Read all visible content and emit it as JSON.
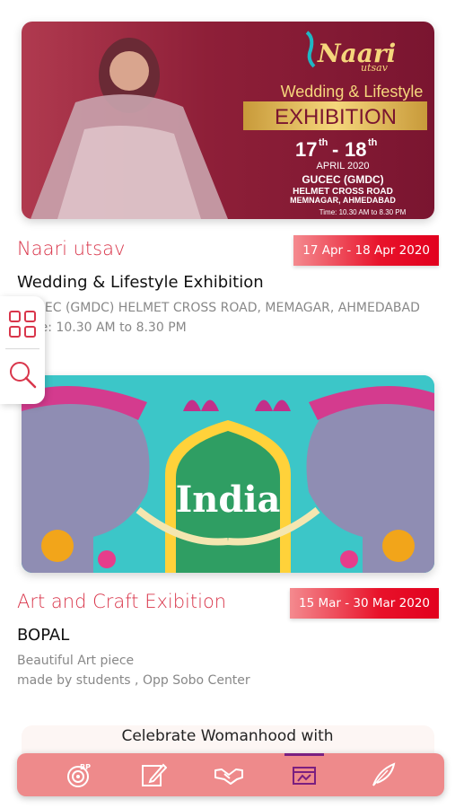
{
  "events": [
    {
      "banner": {
        "brand": "Naari",
        "brand_sub": "utsav",
        "headline_top": "Wedding & Lifestyle",
        "headline_main": "EXHIBITION",
        "date_day_start": "17",
        "date_sup_start": "th",
        "date_dash": "-",
        "date_day_end": "18",
        "date_sup_end": "th",
        "date_month_year": "APRIL 2020",
        "venue_line1": "GUCEC (GMDC)",
        "venue_line2": "HELMET CROSS ROAD",
        "venue_line3": "MEMNAGAR, AHMEDABAD",
        "time": "Time: 10.30 AM to 8.30 PM"
      },
      "title": "Naari utsav",
      "date_range": "17 Apr - 18 Apr 2020",
      "subtitle": "Wedding & Lifestyle Exhibition",
      "description_line1": "GUCEC (GMDC) HELMET CROSS ROAD, MEMAGAR, AHMEDABAD",
      "description_line2": "Time: 10.30 AM to 8.30 PM"
    },
    {
      "banner": {
        "word": "India"
      },
      "title": "Art and Craft Exibition",
      "date_range": "15 Mar - 30 Mar 2020",
      "subtitle": "BOPAL",
      "description_line1": "Beautiful Art piece",
      "description_line2": "made by students , Opp Sobo Center"
    }
  ],
  "next_card_peek": "Celebrate Womanhood with",
  "side_panel": {
    "icons": [
      "grid-icon",
      "search-icon"
    ]
  },
  "bottom_nav": {
    "items": [
      "bp-logo-icon",
      "edit-icon",
      "handshake-icon",
      "exhibition-icon",
      "feather-icon"
    ],
    "active_index": 3
  },
  "colors": {
    "accent": "#d9364b",
    "badge": "#e8122a",
    "nav_bg": "#ee8a8b",
    "active": "#7a1f80"
  }
}
